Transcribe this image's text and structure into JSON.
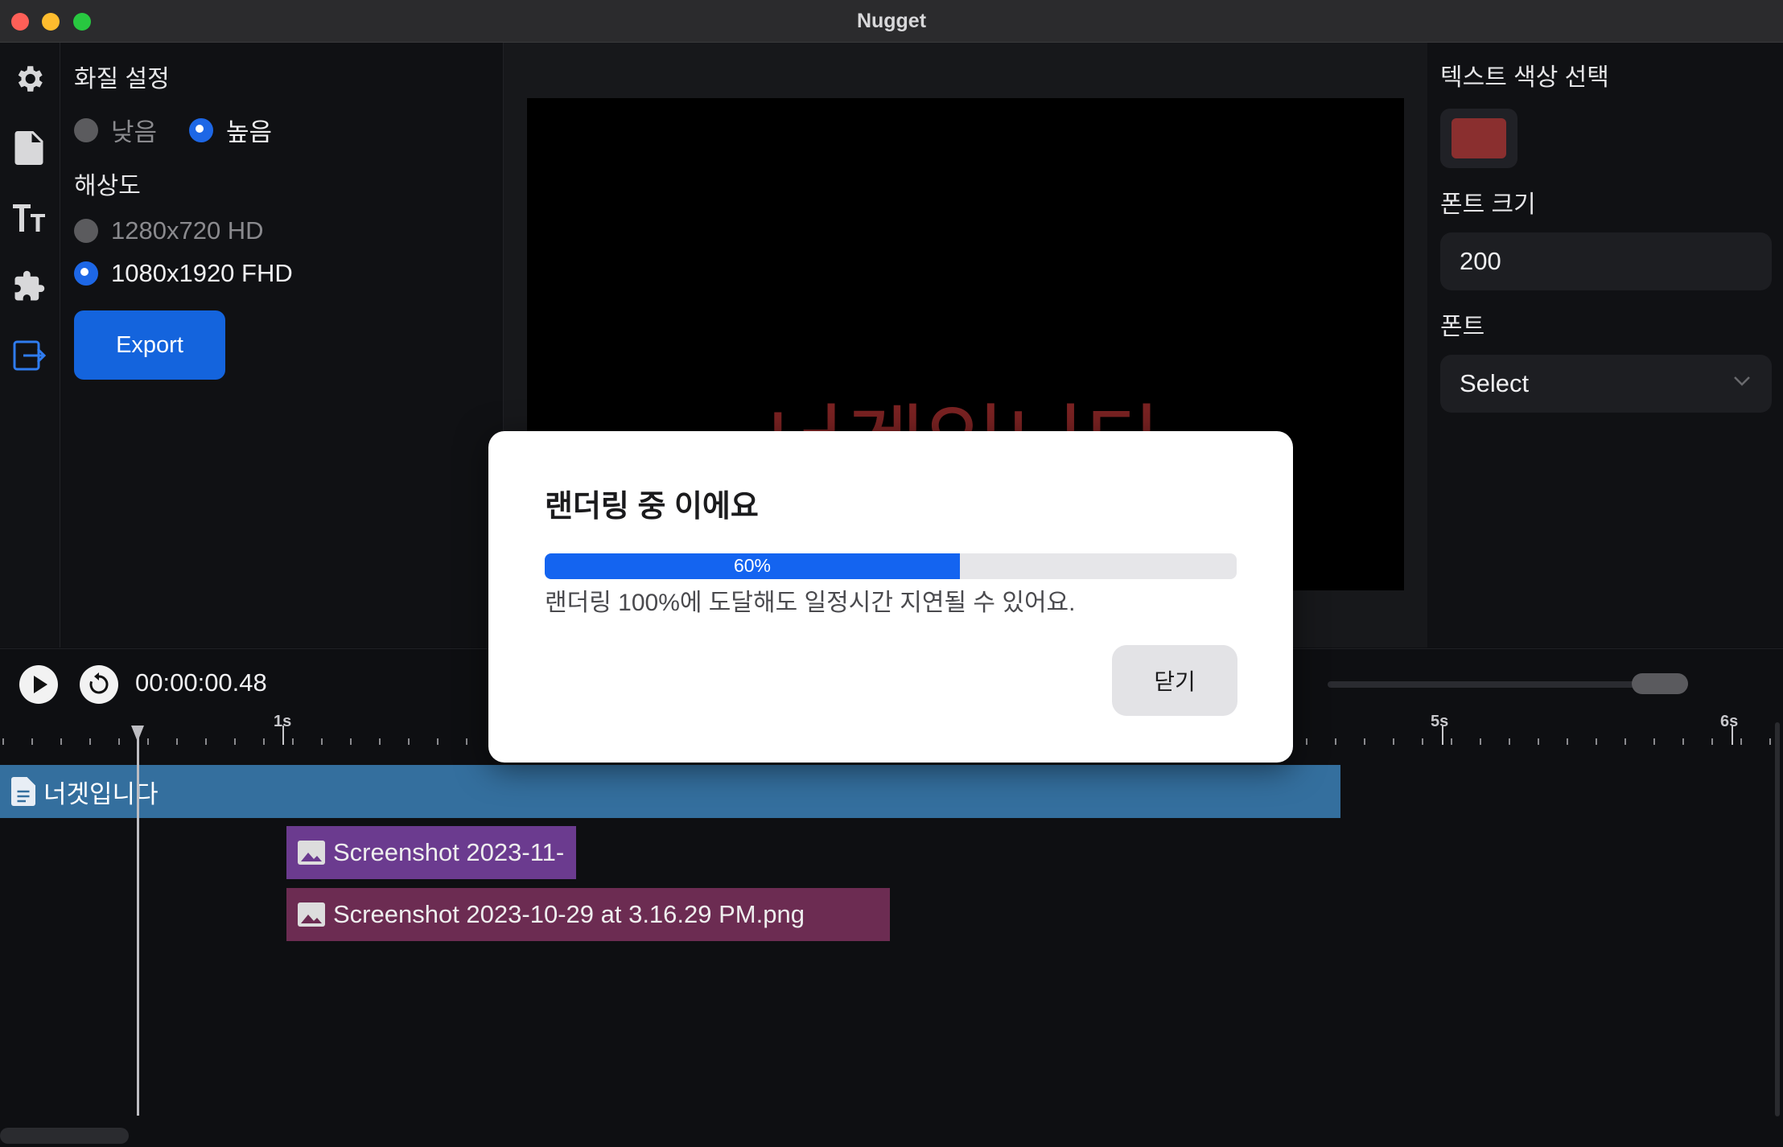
{
  "window": {
    "title": "Nugget"
  },
  "sidebar": {
    "icons": [
      "gear-icon",
      "document-icon",
      "text-size-icon",
      "puzzle-icon",
      "export-icon"
    ]
  },
  "settings": {
    "quality_title": "화질 설정",
    "quality_options": [
      {
        "label": "낮음",
        "selected": false
      },
      {
        "label": "높음",
        "selected": true
      }
    ],
    "resolution_title": "해상도",
    "resolution_options": [
      {
        "label": "1280x720 HD",
        "selected": false
      },
      {
        "label": "1080x1920 FHD",
        "selected": true
      }
    ],
    "export_label": "Export"
  },
  "preview": {
    "text": "너겟입니다"
  },
  "props": {
    "color_title": "텍스트 색상 선택",
    "color_value": "#8a2f2f",
    "font_size_title": "폰트 크기",
    "font_size_value": "200",
    "font_title": "폰트",
    "font_select_value": "Select"
  },
  "timeline": {
    "timecode": "00:00:00.48",
    "ruler_labels": [
      "1s",
      "5s",
      "6s"
    ],
    "text_clip_label": "너겟입니다",
    "image_clips": [
      {
        "label": "Screenshot 2023-11-"
      },
      {
        "label": "Screenshot 2023-10-29 at 3.16.29 PM.png"
      }
    ]
  },
  "modal": {
    "title": "랜더링 중 이에요",
    "progress_percent": 60,
    "progress_label": "60%",
    "note": "랜더링 100%에 도달해도 일정시간 지연될 수 있어요.",
    "close_label": "닫기"
  },
  "colors": {
    "accent": "#1464dd",
    "text_clip": "#346f9e",
    "image_clip_1": "#6b3b8f",
    "image_clip_2": "#6c2c52"
  }
}
